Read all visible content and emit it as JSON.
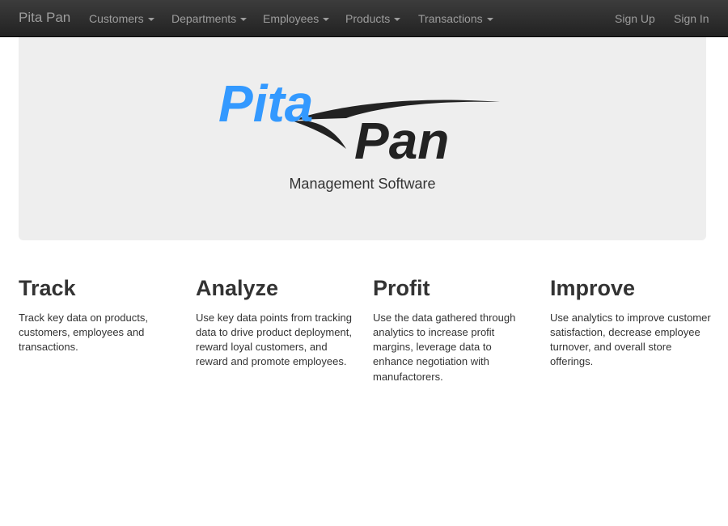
{
  "navbar": {
    "brand": "Pita Pan",
    "menus": [
      {
        "label": "Customers"
      },
      {
        "label": "Departments"
      },
      {
        "label": "Employees"
      },
      {
        "label": "Products"
      },
      {
        "label": "Transactions"
      }
    ],
    "right": {
      "sign_up": "Sign Up",
      "sign_in": "Sign In"
    }
  },
  "hero": {
    "logo_text": "Pita Pan",
    "logo_top_word": "Pita",
    "logo_bottom_word": "Pan",
    "tagline": "Management Software",
    "colors": {
      "logo_blue": "#3399ff",
      "logo_dark": "#222222",
      "background": "#eeeeee"
    }
  },
  "features": [
    {
      "title": "Track",
      "text": "Track key data on products, customers, employees and transactions."
    },
    {
      "title": "Analyze",
      "text": "Use key data points from tracking data to drive product deployment, reward loyal customers, and reward and promote employees."
    },
    {
      "title": "Profit",
      "text": "Use the data gathered through analytics to increase profit margins, leverage data to enhance negotiation with manufactorers."
    },
    {
      "title": "Improve",
      "text": "Use analytics to improve customer satisfaction, decrease employee turnover, and overall store offerings."
    }
  ]
}
